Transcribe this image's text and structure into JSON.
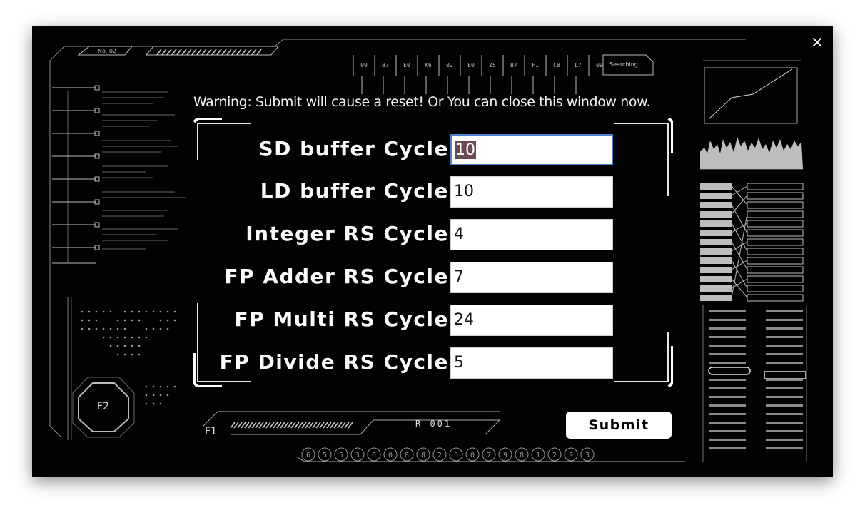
{
  "dialog": {
    "close_glyph": "×",
    "warning": "Warning: Submit will cause a reset! Or You can close this window now.",
    "submit_label": "Submit"
  },
  "fields": [
    {
      "label": "SD buffer Cycle",
      "value": "10"
    },
    {
      "label": "LD buffer Cycle",
      "value": "10"
    },
    {
      "label": "Integer RS Cycle",
      "value": "4"
    },
    {
      "label": "FP Adder RS Cycle",
      "value": "7"
    },
    {
      "label": "FP Multi RS Cycle",
      "value": "24"
    },
    {
      "label": "FP Divide RS Cycle",
      "value": "5"
    }
  ],
  "background_hud": {
    "top_left_tag": "No. 02",
    "top_codes": [
      "09",
      "B7",
      "E0",
      "K6",
      "02",
      "E0",
      "Z5",
      "B7",
      "F1",
      "C8",
      "L7",
      "09"
    ],
    "top_status": "Searching",
    "octagon_label": "F2",
    "bottom_left_label": "F1",
    "bottom_readout": "R 001",
    "bottom_digits": [
      "6",
      "5",
      "5",
      "3",
      "6",
      "0",
      "8",
      "8",
      "2",
      "5",
      "0",
      "7",
      "9",
      "8",
      "1",
      "2",
      "9",
      "3"
    ]
  },
  "colors": {
    "window_bg": "#020202",
    "text": "#f2f2f2",
    "input_bg": "#ffffff",
    "focus_border": "#4a7fd0",
    "selection": "#6b4a52"
  }
}
